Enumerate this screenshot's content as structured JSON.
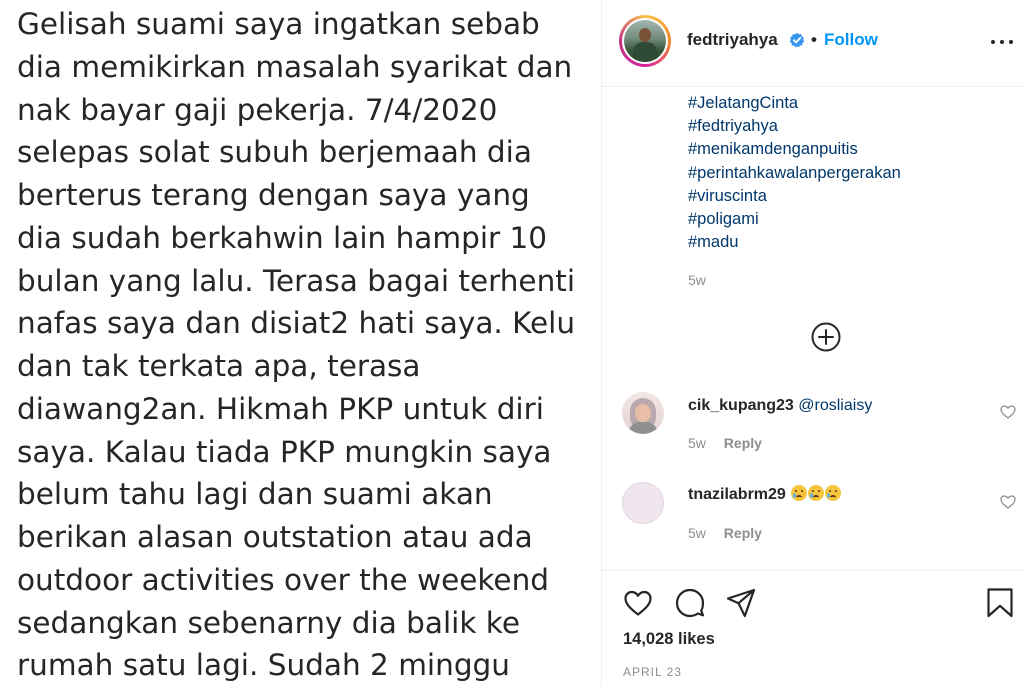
{
  "post": {
    "lines": [
      "Gelisah suami saya ingatkan sebab",
      "dia memikirkan masalah syarikat dan",
      "nak bayar gaji pekerja. 7/4/2020",
      "selepas solat subuh berjemaah dia",
      "berterus terang dengan saya yang",
      "dia sudah berkahwin lain hampir 10",
      "bulan yang lalu. Terasa bagai terhenti",
      "nafas saya dan disiat2 hati saya. Kelu",
      "dan tak terkata apa, terasa",
      "diawang2an. Hikmah PKP untuk diri",
      "saya. Kalau tiada PKP mungkin saya",
      "belum tahu lagi dan suami akan",
      "berikan alasan outstation atau ada",
      "outdoor activities over the weekend",
      "sedangkan sebenarny dia balik ke",
      "rumah satu lagi. Sudah 2 minggu"
    ]
  },
  "header": {
    "username": "fedtriyahya",
    "separator": "•",
    "follow_label": "Follow",
    "verified_icon": "verified-badge-icon",
    "more_icon": "more-options-icon"
  },
  "caption": {
    "hashtags": [
      "#JelatangCinta",
      "#fedtriyahya",
      "#menikamdenganpuitis",
      "#perintahkawalanpergerakan",
      "#viruscinta",
      "#poligami",
      "#madu"
    ],
    "time": "5w",
    "load_more_icon": "plus-circle-icon"
  },
  "comments": [
    {
      "username": "cik_kupang23",
      "text": "@rosliaisy",
      "time": "5w",
      "reply_label": "Reply"
    },
    {
      "username": "tnazilabrm29",
      "text": "",
      "emoji_count": 3,
      "time": "5w",
      "reply_label": "Reply"
    }
  ],
  "actions": {
    "like_icon": "heart-icon",
    "comment_icon": "comment-icon",
    "share_icon": "share-icon",
    "save_icon": "bookmark-icon",
    "likes_text": "14,028 likes",
    "date": "APRIL 23"
  },
  "colors": {
    "link": "#00376b",
    "follow": "#0095f6",
    "muted": "#8e8e8e",
    "text": "#262626"
  }
}
